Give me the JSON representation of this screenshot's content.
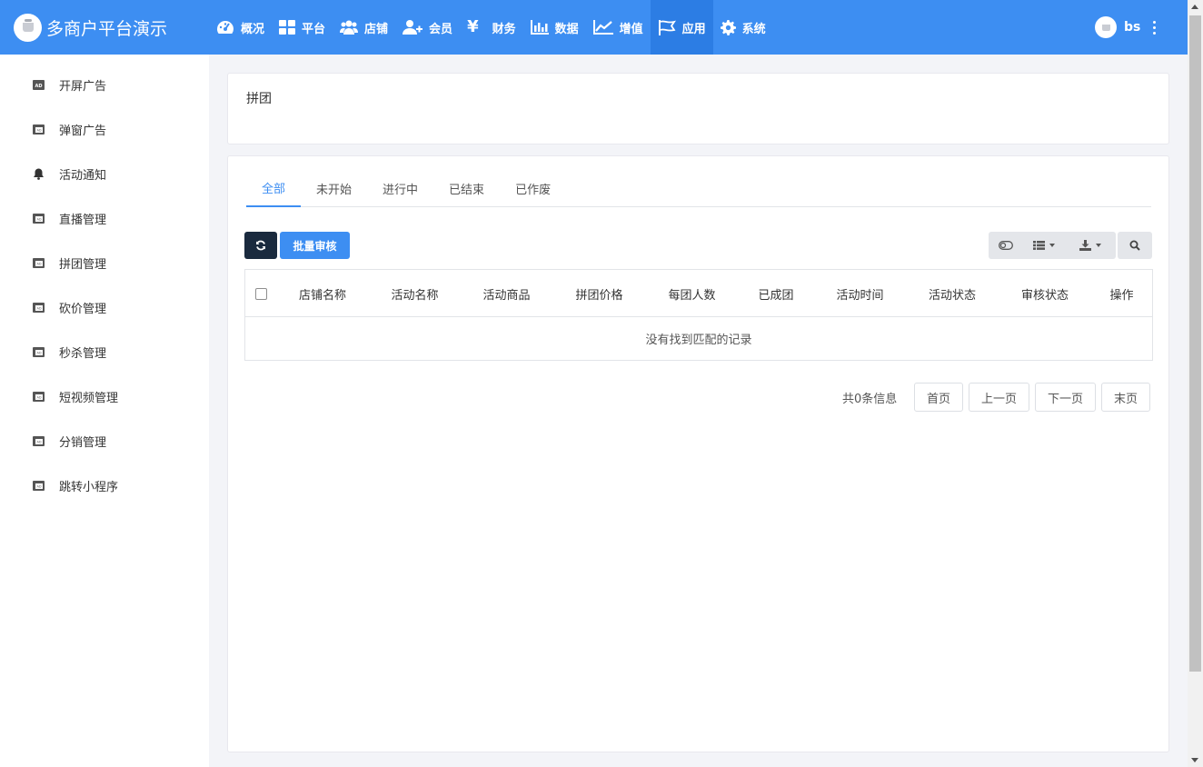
{
  "app": {
    "title": "多商户平台演示"
  },
  "nav": {
    "items": [
      {
        "label": "概况",
        "icon": "dashboard-icon"
      },
      {
        "label": "平台",
        "icon": "grid-icon"
      },
      {
        "label": "店铺",
        "icon": "users-icon"
      },
      {
        "label": "会员",
        "icon": "user-plus-icon"
      },
      {
        "label": "财务",
        "icon": "yen-icon"
      },
      {
        "label": "数据",
        "icon": "bar-chart-icon"
      },
      {
        "label": "增值",
        "icon": "line-chart-icon"
      },
      {
        "label": "应用",
        "icon": "flag-icon",
        "active": true
      },
      {
        "label": "系统",
        "icon": "gear-icon"
      }
    ],
    "yen_symbol": "¥"
  },
  "user": {
    "name": "bs"
  },
  "sidebar": {
    "items": [
      {
        "label": "开屏广告",
        "icon": "ad-icon"
      },
      {
        "label": "弹窗广告",
        "icon": "ad-icon"
      },
      {
        "label": "活动通知",
        "icon": "bell-icon"
      },
      {
        "label": "直播管理",
        "icon": "ad-icon"
      },
      {
        "label": "拼团管理",
        "icon": "ad-icon"
      },
      {
        "label": "砍价管理",
        "icon": "ad-icon"
      },
      {
        "label": "秒杀管理",
        "icon": "ad-icon"
      },
      {
        "label": "短视频管理",
        "icon": "ad-icon"
      },
      {
        "label": "分销管理",
        "icon": "ad-icon"
      },
      {
        "label": "跳转小程序",
        "icon": "ad-icon"
      }
    ],
    "ad_badge": "AD"
  },
  "page": {
    "title": "拼团"
  },
  "tabs": [
    {
      "label": "全部",
      "active": true
    },
    {
      "label": "未开始"
    },
    {
      "label": "进行中"
    },
    {
      "label": "已结束"
    },
    {
      "label": "已作废"
    }
  ],
  "toolbar": {
    "batch_label": "批量审核"
  },
  "table": {
    "columns": [
      "店铺名称",
      "活动名称",
      "活动商品",
      "拼团价格",
      "每团人数",
      "已成团",
      "活动时间",
      "活动状态",
      "审核状态",
      "操作"
    ],
    "empty_text": "没有找到匹配的记录"
  },
  "pagination": {
    "info": "共0条信息",
    "first": "首页",
    "prev": "上一页",
    "next": "下一页",
    "last": "末页"
  },
  "colors": {
    "primary": "#3d8ef2",
    "dark": "#1a2a3e"
  }
}
